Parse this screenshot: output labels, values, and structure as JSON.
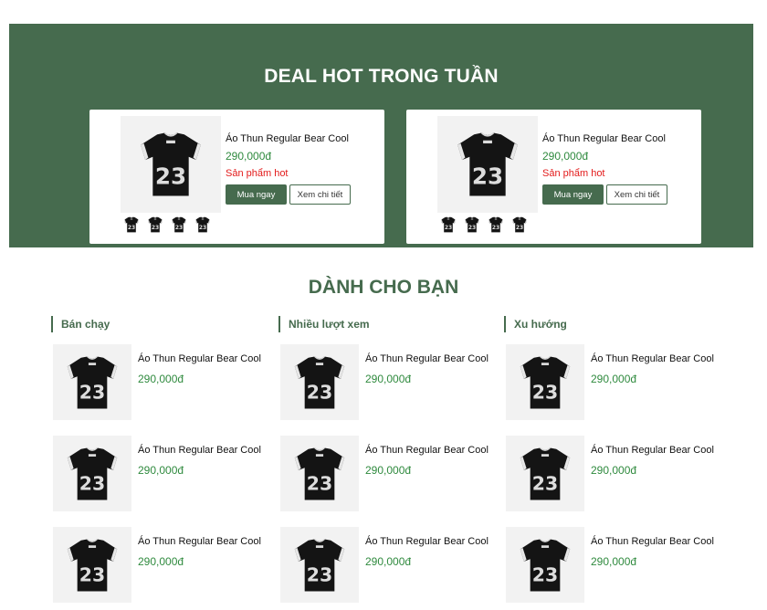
{
  "deal": {
    "title": "DEAL HOT TRONG TUẦN",
    "cards": [
      {
        "name": "Áo Thun Regular Bear Cool",
        "price": "290,000đ",
        "hot": "Sản phẩm hot",
        "buy": "Mua ngay",
        "detail": "Xem chi tiết"
      },
      {
        "name": "Áo Thun Regular Bear Cool",
        "price": "290,000đ",
        "hot": "Sản phẩm hot",
        "buy": "Mua ngay",
        "detail": "Xem chi tiết"
      }
    ]
  },
  "foryou": {
    "title": "DÀNH CHO BẠN",
    "columns": [
      {
        "heading": "Bán chạy",
        "items": [
          {
            "name": "Áo Thun Regular Bear Cool",
            "price": "290,000đ"
          },
          {
            "name": "Áo Thun Regular Bear Cool",
            "price": "290,000đ"
          },
          {
            "name": "Áo Thun Regular Bear Cool",
            "price": "290,000đ"
          }
        ]
      },
      {
        "heading": "Nhiều lượt xem",
        "items": [
          {
            "name": "Áo Thun Regular Bear Cool",
            "price": "290,000đ"
          },
          {
            "name": "Áo Thun Regular Bear Cool",
            "price": "290,000đ"
          },
          {
            "name": "Áo Thun Regular Bear Cool",
            "price": "290,000đ"
          }
        ]
      },
      {
        "heading": "Xu hướng",
        "items": [
          {
            "name": "Áo Thun Regular Bear Cool",
            "price": "290,000đ"
          },
          {
            "name": "Áo Thun Regular Bear Cool",
            "price": "290,000đ"
          },
          {
            "name": "Áo Thun Regular Bear Cool",
            "price": "290,000đ"
          }
        ]
      }
    ]
  },
  "colors": {
    "brand": "#466b4e",
    "price": "#2f8a3e",
    "hot": "#e31b1b"
  },
  "icons": {
    "product": "jersey-23-image"
  }
}
